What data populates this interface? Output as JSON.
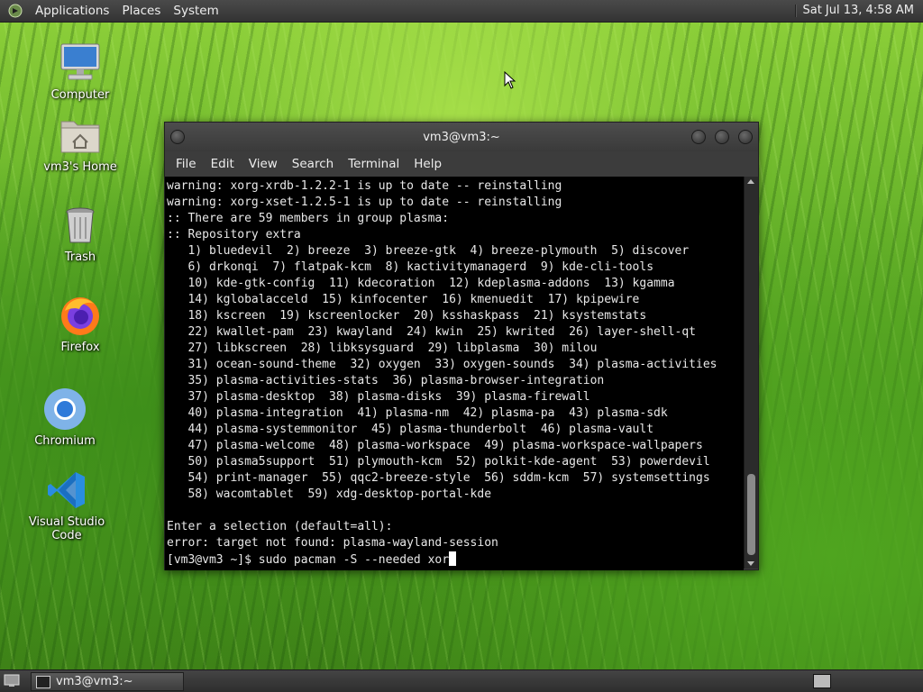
{
  "top_panel": {
    "menus": [
      "Applications",
      "Places",
      "System"
    ],
    "clock": "Sat Jul 13,  4:58 AM"
  },
  "desktop": {
    "icons": [
      {
        "label": "Computer",
        "icon": "computer-icon"
      },
      {
        "label": "vm3's Home",
        "icon": "home-folder-icon"
      },
      {
        "label": "Trash",
        "icon": "trash-icon"
      },
      {
        "label": "Firefox",
        "icon": "firefox-icon"
      },
      {
        "label": "Chromium",
        "icon": "chromium-icon"
      },
      {
        "label": "Visual Studio Code",
        "icon": "vscode-icon"
      }
    ]
  },
  "terminal": {
    "title": "vm3@vm3:~",
    "menu": [
      "File",
      "Edit",
      "View",
      "Search",
      "Terminal",
      "Help"
    ],
    "lines": [
      "warning: xorg-xrdb-1.2.2-1 is up to date -- reinstalling",
      "warning: xorg-xset-1.2.5-1 is up to date -- reinstalling",
      ":: There are 59 members in group plasma:",
      ":: Repository extra",
      "   1) bluedevil  2) breeze  3) breeze-gtk  4) breeze-plymouth  5) discover",
      "   6) drkonqi  7) flatpak-kcm  8) kactivitymanagerd  9) kde-cli-tools",
      "   10) kde-gtk-config  11) kdecoration  12) kdeplasma-addons  13) kgamma",
      "   14) kglobalacceld  15) kinfocenter  16) kmenuedit  17) kpipewire",
      "   18) kscreen  19) kscreenlocker  20) ksshaskpass  21) ksystemstats",
      "   22) kwallet-pam  23) kwayland  24) kwin  25) kwrited  26) layer-shell-qt",
      "   27) libkscreen  28) libksysguard  29) libplasma  30) milou",
      "   31) ocean-sound-theme  32) oxygen  33) oxygen-sounds  34) plasma-activities",
      "   35) plasma-activities-stats  36) plasma-browser-integration",
      "   37) plasma-desktop  38) plasma-disks  39) plasma-firewall",
      "   40) plasma-integration  41) plasma-nm  42) plasma-pa  43) plasma-sdk",
      "   44) plasma-systemmonitor  45) plasma-thunderbolt  46) plasma-vault",
      "   47) plasma-welcome  48) plasma-workspace  49) plasma-workspace-wallpapers",
      "   50) plasma5support  51) plymouth-kcm  52) polkit-kde-agent  53) powerdevil",
      "   54) print-manager  55) qqc2-breeze-style  56) sddm-kcm  57) systemsettings",
      "   58) wacomtablet  59) xdg-desktop-portal-kde",
      "",
      "Enter a selection (default=all):",
      "error: target not found: plasma-wayland-session"
    ],
    "prompt": "[vm3@vm3 ~]$ sudo pacman -S --needed xor"
  },
  "bottom_panel": {
    "task_label": "vm3@vm3:~"
  }
}
